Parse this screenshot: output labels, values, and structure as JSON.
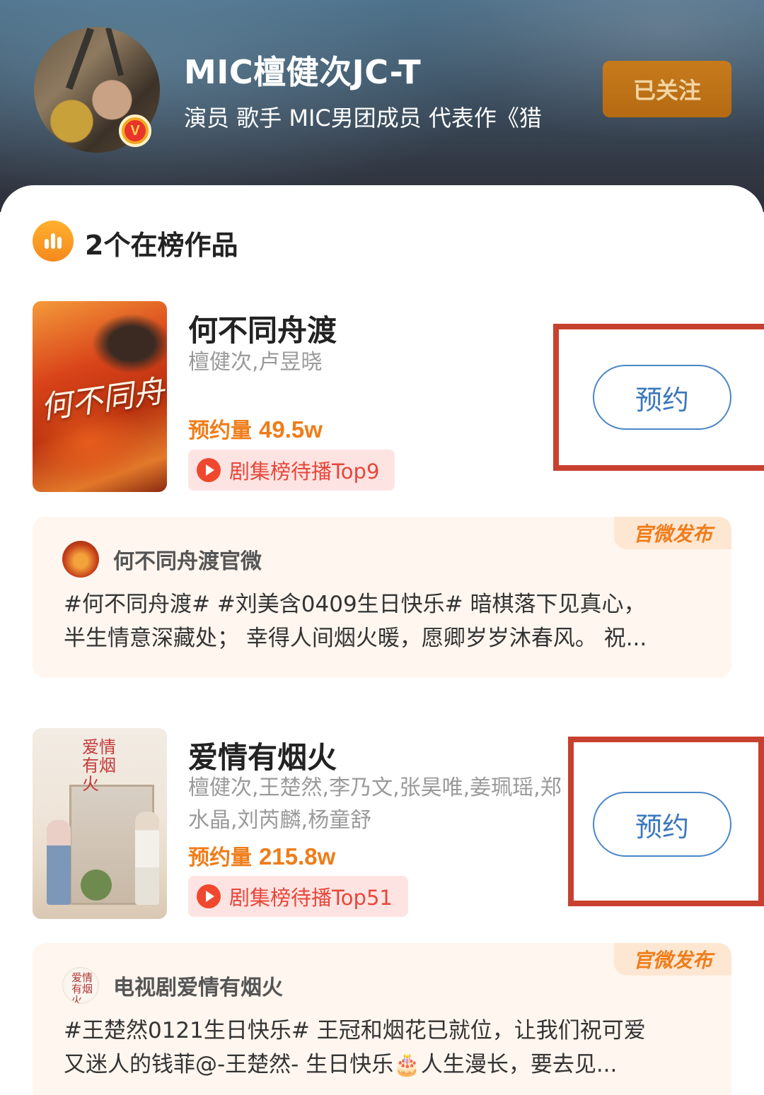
{
  "profile": {
    "name": "MIC檀健次JC-T",
    "description": "演员 歌手 MIC男团成员 代表作《猎",
    "verify_badge": "V",
    "follow_label": "已关注"
  },
  "section": {
    "title": "2个在榜作品",
    "icon": "bar-chart-icon"
  },
  "works": [
    {
      "title": "何不同舟渡",
      "cast": "檀健次,卢昱晓",
      "reserve_label": "预约量",
      "reserve_count": "49.5w",
      "rank": "剧集榜待播Top9",
      "button": "预约",
      "poster_text": "何不同舟渡",
      "post": {
        "tag": "官微发布",
        "author": "何不同舟渡官微",
        "line1": "#何不同舟渡# #刘美含0409生日快乐# 暗棋落下见真心，",
        "line2": "半生情意深藏处； 幸得人间烟火暖，愿卿岁岁沐春风。 祝..."
      }
    },
    {
      "title": "爱情有烟火",
      "cast_line1": "檀健次,王楚然,李乃文,张昊唯,姜珮瑶,郑",
      "cast_line2": "水晶,刘芮麟,杨童舒",
      "reserve_label": "预约量",
      "reserve_count": "215.8w",
      "rank": "剧集榜待播Top51",
      "button": "预约",
      "poster_text": "爱情有烟火",
      "post": {
        "tag": "官微发布",
        "author": "电视剧爱情有烟火",
        "avatar_text": "爱情有烟火",
        "line1": "#王楚然0121生日快乐# 王冠和烟花已就位，让我们祝可爱",
        "line2": "又迷人的钱菲@-王楚然- 生日快乐🎂人生漫长，要去见..."
      }
    }
  ],
  "colors": {
    "accent_orange": "#ef7d1a",
    "follow_button": "#b56a12",
    "reserve_button_border": "#4a86c7",
    "rank_tag_text": "#e8463a",
    "highlight_box": "#c8402f"
  }
}
